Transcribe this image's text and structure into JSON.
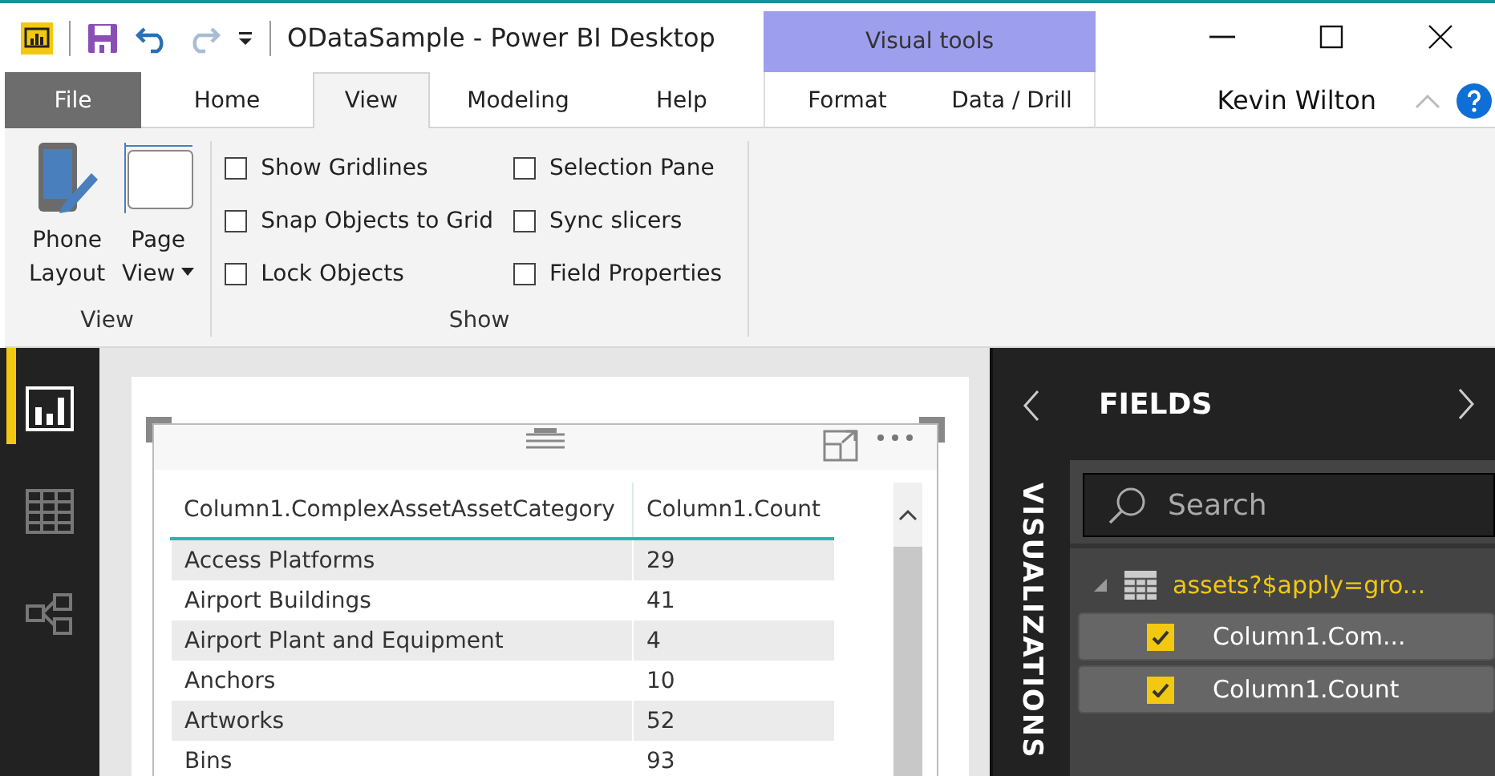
{
  "window": {
    "title": "ODataSample - Power BI Desktop",
    "user": "Kevin Wilton"
  },
  "tabs": [
    {
      "label": "File",
      "kind": "file",
      "selected": false
    },
    {
      "label": "Home",
      "kind": "tab",
      "selected": false
    },
    {
      "label": "View",
      "kind": "tab",
      "selected": true
    },
    {
      "label": "Modeling",
      "kind": "tab",
      "selected": false
    },
    {
      "label": "Help",
      "kind": "tab",
      "selected": false
    }
  ],
  "contextual_group": {
    "title": "Visual tools",
    "tabs": [
      {
        "label": "Format",
        "selected": false
      },
      {
        "label": "Data / Drill",
        "selected": false
      }
    ]
  },
  "ribbon": {
    "groups": [
      {
        "title": "View",
        "kind": "buttons",
        "buttons": [
          {
            "label": "Phone Layout",
            "dropdown": false
          },
          {
            "label": "Page View",
            "dropdown": true
          }
        ]
      },
      {
        "title": "Show",
        "kind": "checkboxes",
        "checkboxes": [
          {
            "label": "Show Gridlines",
            "checked": false
          },
          {
            "label": "Snap Objects to Grid",
            "checked": false
          },
          {
            "label": "Lock Objects",
            "checked": false
          },
          {
            "label": "Selection Pane",
            "checked": false
          },
          {
            "label": "Sync slicers",
            "checked": false
          },
          {
            "label": "Field Properties",
            "checked": false
          }
        ]
      }
    ]
  },
  "view_rail": [
    {
      "selected": true
    },
    {
      "selected": false
    },
    {
      "selected": false
    }
  ],
  "table": {
    "columns": [
      "Column1.ComplexAssetAssetCategory",
      "Column1.Count"
    ],
    "rows": [
      [
        "Access Platforms",
        "29"
      ],
      [
        "Airport Buildings",
        "41"
      ],
      [
        "Airport Plant and Equipment",
        "4"
      ],
      [
        "Anchors",
        "10"
      ],
      [
        "Artworks",
        "52"
      ],
      [
        "Bins",
        "93"
      ]
    ]
  },
  "visualizations_pane": {
    "label": "VISUALIZATIONS"
  },
  "fields_pane": {
    "title": "FIELDS",
    "search": {
      "placeholder": "Search"
    },
    "tables": [
      {
        "name": "assets?$apply=gro...",
        "expanded": true,
        "children": [
          {
            "name": "Column1.Com...",
            "checked": true
          },
          {
            "name": "Column1.Count",
            "checked": true
          }
        ]
      }
    ]
  }
}
